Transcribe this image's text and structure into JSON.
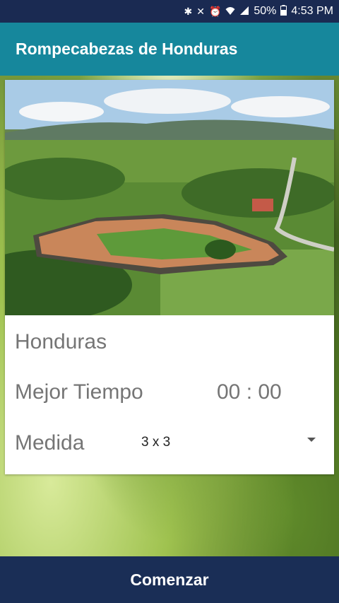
{
  "status_bar": {
    "battery": "50%",
    "time": "4:53 PM",
    "icons": [
      "bluetooth-icon",
      "mute-icon",
      "alarm-icon",
      "wifi-icon",
      "signal-icon",
      "battery-icon"
    ]
  },
  "app": {
    "title": "Rompecabezas de Honduras"
  },
  "puzzle": {
    "name": "Honduras",
    "best_time_label": "Mejor Tiempo",
    "best_time_value": "00 : 00",
    "size_label": "Medida",
    "size_value": "3 x 3"
  },
  "actions": {
    "start_label": "Comenzar"
  },
  "colors": {
    "status_bar": "#1a2a52",
    "app_bar": "#16879c",
    "button": "#1a2e56"
  }
}
